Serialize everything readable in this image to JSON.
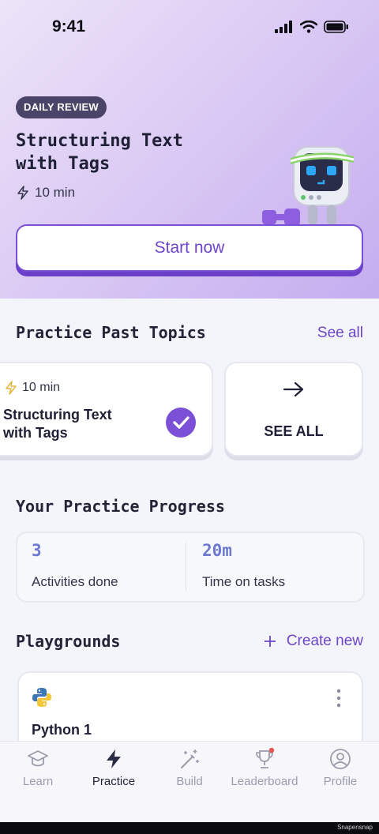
{
  "status": {
    "time": "9:41"
  },
  "hero": {
    "badge": "DAILY REVIEW",
    "title_line1": "Structuring Text",
    "title_line2": "with Tags",
    "duration": "10 min",
    "start_label": "Start now"
  },
  "practice_past": {
    "title": "Practice Past Topics",
    "see_all": "See all",
    "topic_card": {
      "duration": "10 min",
      "title_line1": "Structuring Text",
      "title_line2": "with Tags"
    },
    "see_all_card": "SEE ALL"
  },
  "progress": {
    "title": "Your Practice Progress",
    "stats": [
      {
        "value": "3",
        "label": "Activities done"
      },
      {
        "value": "20m",
        "label": "Time on tasks"
      }
    ]
  },
  "playgrounds": {
    "title": "Playgrounds",
    "create_new": "Create new",
    "items": [
      {
        "name": "Python 1",
        "icon": "python-icon"
      }
    ]
  },
  "tabbar": {
    "tabs": [
      {
        "label": "Learn",
        "icon": "graduation-cap-icon"
      },
      {
        "label": "Practice",
        "icon": "lightning-icon"
      },
      {
        "label": "Build",
        "icon": "magic-wand-icon"
      },
      {
        "label": "Leaderboard",
        "icon": "trophy-icon"
      },
      {
        "label": "Profile",
        "icon": "user-circle-icon"
      }
    ],
    "active": "Practice"
  },
  "watermark": "Snapensnap",
  "colors": {
    "accent": "#6d45c8",
    "stat_value": "#6d78d0",
    "badge_bg": "#4a4568"
  }
}
